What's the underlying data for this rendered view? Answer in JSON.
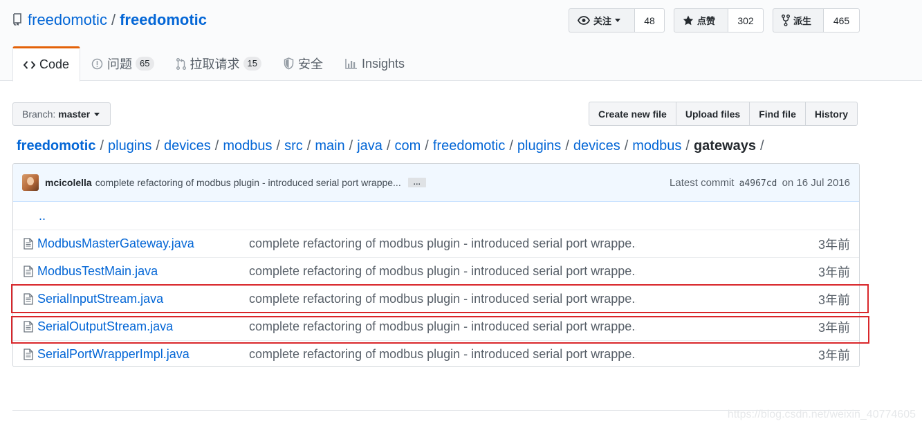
{
  "repo": {
    "owner": "freedomotic",
    "separator": "/",
    "name": "freedomotic"
  },
  "actions": {
    "watch": {
      "label": "关注",
      "count": "48"
    },
    "star": {
      "label": "点赞",
      "count": "302"
    },
    "fork": {
      "label": "派生",
      "count": "465"
    }
  },
  "tabs": [
    {
      "label": "Code"
    },
    {
      "label": "问题",
      "count": "65"
    },
    {
      "label": "拉取请求",
      "count": "15"
    },
    {
      "label": "安全"
    },
    {
      "label": "Insights"
    }
  ],
  "branch": {
    "prefix": "Branch:",
    "value": "master"
  },
  "file_actions": [
    "Create new file",
    "Upload files",
    "Find file",
    "History"
  ],
  "breadcrumb": {
    "path": [
      "freedomotic",
      "plugins",
      "devices",
      "modbus",
      "src",
      "main",
      "java",
      "com",
      "freedomotic",
      "plugins",
      "devices",
      "modbus"
    ],
    "current": "gateways",
    "separator": "/"
  },
  "commit": {
    "author": "mcicolella",
    "message": "complete refactoring of modbus plugin - introduced serial port wrappe...",
    "ellipsis": "…",
    "latest_prefix": "Latest commit",
    "sha": "a4967cd",
    "date_prefix": "on",
    "date": "16 Jul 2016"
  },
  "parent_link": "..",
  "files": [
    {
      "name": "ModbusMasterGateway.java",
      "message": "complete refactoring of modbus plugin - introduced serial port wrappe...",
      "age": "3年前"
    },
    {
      "name": "ModbusTestMain.java",
      "message": "complete refactoring of modbus plugin - introduced serial port wrappe...",
      "age": "3年前"
    },
    {
      "name": "SerialInputStream.java",
      "message": "complete refactoring of modbus plugin - introduced serial port wrappe...",
      "age": "3年前"
    },
    {
      "name": "SerialOutputStream.java",
      "message": "complete refactoring of modbus plugin - introduced serial port wrappe...",
      "age": "3年前"
    },
    {
      "name": "SerialPortWrapperImpl.java",
      "message": "complete refactoring of modbus plugin - introduced serial port wrappe...",
      "age": "3年前"
    }
  ],
  "watermark": "https://blog.csdn.net/weixin_40774605",
  "colors": {
    "link": "#0366d6",
    "tab_accent": "#e36209",
    "highlight_box": "#d9262a",
    "commit_bar": "#f1f8ff"
  }
}
